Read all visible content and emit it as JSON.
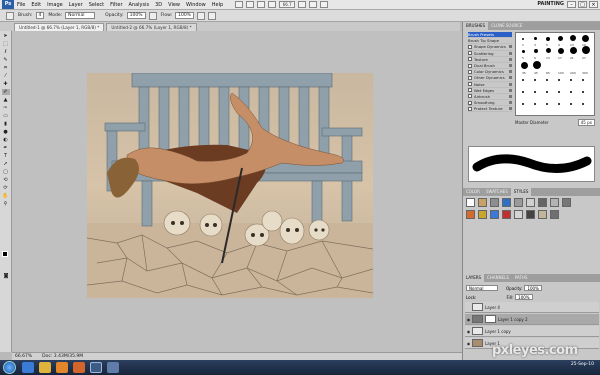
{
  "app": {
    "logo_text": "Ps",
    "workspace": "PAINTING"
  },
  "menu": {
    "items": [
      "File",
      "Edit",
      "Image",
      "Layer",
      "Select",
      "Filter",
      "Analysis",
      "3D",
      "View",
      "Window",
      "Help"
    ],
    "zoom": "66.7"
  },
  "options": {
    "brush_label": "Brush:",
    "brush_size": "4",
    "mode_label": "Mode:",
    "mode_value": "Normal",
    "opacity_label": "Opacity:",
    "opacity_value": "100%",
    "flow_label": "Flow:",
    "flow_value": "100%"
  },
  "tabs": [
    {
      "label": "Untitled-1 @ 66.7% (Layer 1, RGB/8) *"
    },
    {
      "label": "Untitled-2 @ 66.7% (Layer 1, RGB/8) *"
    }
  ],
  "status": {
    "zoom": "66.67%",
    "doc": "Doc: 3.43M/35.9M"
  },
  "brushes_panel": {
    "tabs": [
      "BRUSHES",
      "CLONE SOURCE"
    ],
    "items": [
      "Brush Presets",
      "Brush Tip Shape",
      "Shape Dynamics",
      "Scattering",
      "Texture",
      "Dual Brush",
      "Color Dynamics",
      "Other Dynamics",
      "Noise",
      "Wet Edges",
      "Airbrush",
      "Smoothing",
      "Protect Texture"
    ],
    "master_diameter_label": "Master Diameter",
    "master_diameter_value": "45 px",
    "grid_numbers": [
      "1",
      "3",
      "5",
      "9",
      "13",
      "19",
      "5",
      "9",
      "13",
      "17",
      "21",
      "27",
      "35",
      "45",
      "65",
      "100",
      "200",
      "300"
    ]
  },
  "styles_panel": {
    "tabs": [
      "COLOR",
      "SWATCHES",
      "STYLES"
    ]
  },
  "layers_panel": {
    "tabs": [
      "LAYERS",
      "CHANNELS",
      "PATHS"
    ],
    "blend": "Normal",
    "opacity_label": "Opacity:",
    "opacity": "100%",
    "lock_label": "Lock:",
    "fill_label": "Fill:",
    "fill": "100%",
    "layers": [
      "Layer 4",
      "Layer 1 copy 2",
      "Layer 1 copy",
      "Layer 1"
    ]
  },
  "watermark": "pxleyes.com",
  "clock": {
    "time": "25-Sep-10"
  }
}
